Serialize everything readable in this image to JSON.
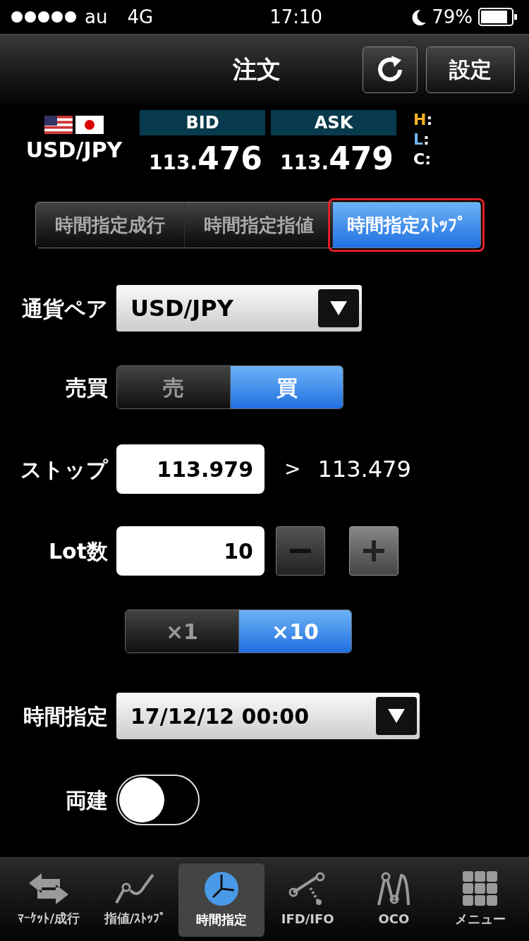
{
  "status_bar": {
    "carrier": "au",
    "network": "4G",
    "time": "17:10",
    "battery": "79%"
  },
  "header": {
    "title": "注文",
    "settings_button": "設定"
  },
  "quote": {
    "pair": "USD/JPY",
    "bid": {
      "label": "BID",
      "prefix": "113.",
      "main": "476"
    },
    "ask": {
      "label": "ASK",
      "prefix": "113.",
      "main": "479"
    },
    "hlc": [
      {
        "label": "H",
        "separator": ":",
        "color": "#f5b323"
      },
      {
        "label": "L",
        "separator": ":",
        "color": "#6fb3f0"
      },
      {
        "label": "C",
        "separator": ":",
        "color": "#ffffff"
      }
    ]
  },
  "order_tabs": [
    {
      "label": "時間指定成行",
      "selected": false
    },
    {
      "label": "時間指定指値",
      "selected": false
    },
    {
      "label": "時間指定ｽﾄｯﾌﾟ",
      "selected": true,
      "highlighted": true
    }
  ],
  "form": {
    "pair": {
      "label": "通貨ペア",
      "value": "USD/JPY"
    },
    "side": {
      "label": "売買",
      "options": [
        {
          "label": "売",
          "selected": false
        },
        {
          "label": "買",
          "selected": true
        }
      ]
    },
    "stop": {
      "label": "ストップ",
      "value": "113.979",
      "comparator": ">",
      "reference": "113.479"
    },
    "lot": {
      "label": "Lot数",
      "value": "10"
    },
    "multiplier": [
      {
        "label": "×1",
        "selected": false
      },
      {
        "label": "×10",
        "selected": true
      }
    ],
    "time": {
      "label": "時間指定",
      "value": "17/12/12 00:00"
    },
    "hedge": {
      "label": "両建",
      "on": false
    }
  },
  "nav": [
    {
      "label": "ﾏｰｹｯﾄ/成行",
      "kind": "arrows",
      "selected": false
    },
    {
      "label": "指値/ｽﾄｯﾌﾟ",
      "kind": "curve",
      "selected": false
    },
    {
      "label": "時間指定",
      "kind": "clock",
      "selected": true
    },
    {
      "label": "IFD/IFO",
      "kind": "ifd",
      "selected": false
    },
    {
      "label": "OCO",
      "kind": "oco",
      "selected": false
    },
    {
      "label": "メニュー",
      "kind": "grid",
      "selected": false
    }
  ]
}
